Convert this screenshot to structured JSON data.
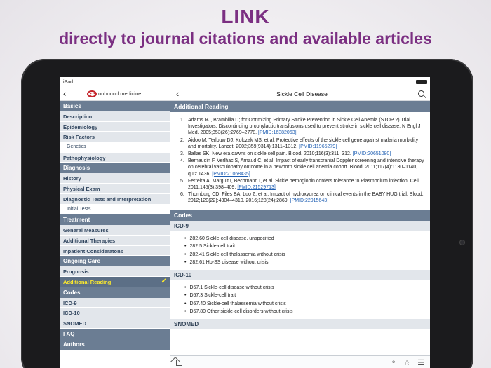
{
  "headline": "LINK",
  "subline": "directly to journal citations and available articles",
  "status": {
    "device": "iPad"
  },
  "sidebar": {
    "logo_text": "unbound medicine",
    "items": [
      {
        "label": "Basics",
        "type": "head"
      },
      {
        "label": "Description",
        "type": "item"
      },
      {
        "label": "Epidemiology",
        "type": "item"
      },
      {
        "label": "Risk Factors",
        "type": "item"
      },
      {
        "label": "Genetics",
        "type": "sub"
      },
      {
        "label": "Pathophysiology",
        "type": "item"
      },
      {
        "label": "Diagnosis",
        "type": "head"
      },
      {
        "label": "History",
        "type": "item"
      },
      {
        "label": "Physical Exam",
        "type": "item"
      },
      {
        "label": "Diagnostic Tests and Interpretation",
        "type": "item"
      },
      {
        "label": "Initial Tests",
        "type": "sub"
      },
      {
        "label": "Treatment",
        "type": "head"
      },
      {
        "label": "General Measures",
        "type": "item"
      },
      {
        "label": "Additional Therapies",
        "type": "item"
      },
      {
        "label": "Inpatient Consideratons",
        "type": "item"
      },
      {
        "label": "Ongoing Care",
        "type": "head"
      },
      {
        "label": "Prognosis",
        "type": "item"
      },
      {
        "label": "Additional Reading",
        "type": "active"
      },
      {
        "label": "Codes",
        "type": "head"
      },
      {
        "label": "ICD-9",
        "type": "item"
      },
      {
        "label": "ICD-10",
        "type": "item"
      },
      {
        "label": "SNOMED",
        "type": "item"
      },
      {
        "label": "FAQ",
        "type": "head"
      },
      {
        "label": "Authors",
        "type": "head"
      }
    ]
  },
  "content": {
    "title": "Sickle Cell Disease",
    "reading_heading": "Additional Reading",
    "references": [
      {
        "n": "1.",
        "text": "Adams RJ, Brambilla D; for Optimizing Primary Stroke Prevention in Sickle Cell Anemia (STOP 2) Trial Investigators. Discontinuing prophylactic transfusions used to prevent stroke in sickle cell disease. N Engl J Med. 2005;353(26):2769–2778.",
        "pmid": "[PMID:16382063]"
      },
      {
        "n": "2.",
        "text": "Aidoo M, Terlouw DJ, Kolczak MS, et al. Protective effects of the sickle cell gene against malaria morbidity and mortality. Lancet. 2002;359(9314):1311–1312.",
        "pmid": "[PMID:11965279]"
      },
      {
        "n": "3.",
        "text": "Ballas SK. New era dawns on sickle cell pain. Blood. 2010;116(3):311–312.",
        "pmid": "[PMID:20651080]"
      },
      {
        "n": "4.",
        "text": "Bernaudin F, Verlhac S, Arnaud C, et al. Impact of early transcranial Doppler screening and intensive therapy on cerebral vasculopathy outcome in a newborn sickle cell anemia cohort. Blood. 2011;117(4):1130–1140, quiz 1436.",
        "pmid": "[PMID:21068435]"
      },
      {
        "n": "5.",
        "text": "Ferreira A, Marguit I, Bechmann I, et al. Sickle hemoglobin confers tolerance to Plasmodium infection. Cell. 2011;145(3):398–409.",
        "pmid": "[PMID:21529713]"
      },
      {
        "n": "6.",
        "text": "Thornburg CD, Files BA, Luo Z, et al. Impact of hydroxyurea on clinical events in the BABY HUG trial. Blood. 2012;120(22):4304–4310. 2016;128(24):2869.",
        "pmid": "[PMID:22915643]"
      }
    ],
    "codes_heading": "Codes",
    "icd9_heading": "ICD-9",
    "icd9": [
      "282.60 Sickle-cell disease, unspecified",
      "282.5 Sickle-cell trait",
      "282.41 Sickle-cell thalassemia without crisis",
      "282.61 Hb-SS disease without crisis"
    ],
    "icd10_heading": "ICD-10",
    "icd10": [
      "D57.1 Sickle-cell disease without crisis",
      "D57.3 Sickle-cell trait",
      "D57.40 Sickle-cell thalassemia without crisis",
      "D57.80 Other sickle-cell disorders without crisis"
    ],
    "snomed_heading": "SNOMED"
  },
  "colors": {
    "headline": "#7b2f82",
    "section_head": "#6b7d93",
    "active_text": "#ffec2b",
    "link": "#1f5fb3"
  }
}
